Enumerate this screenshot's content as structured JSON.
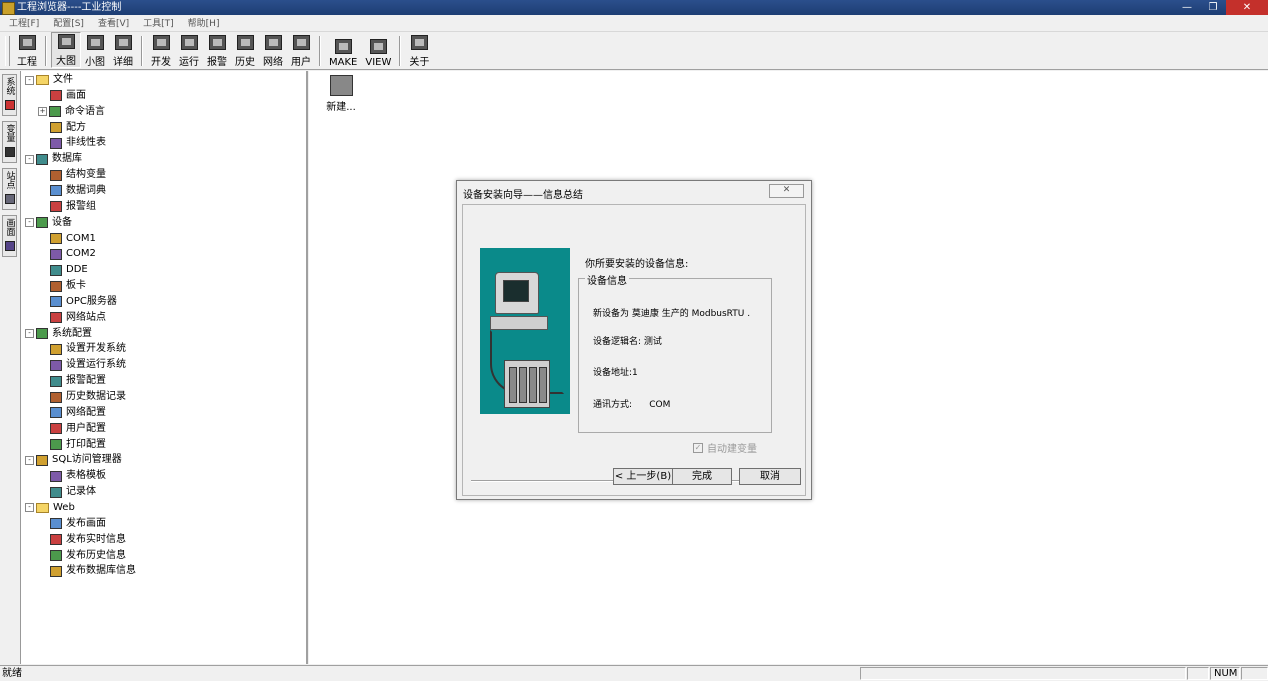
{
  "window": {
    "title": "工程浏览器----工业控制"
  },
  "menu": [
    "工程[F]",
    "配置[S]",
    "查看[V]",
    "工具[T]",
    "帮助[H]"
  ],
  "toolbar": [
    {
      "label": "工程",
      "icon": "project-icon"
    },
    {
      "label": "大图",
      "icon": "large-icons-icon",
      "active": true
    },
    {
      "label": "小图",
      "icon": "small-icons-icon"
    },
    {
      "label": "详细",
      "icon": "details-icon"
    },
    {
      "label": "开发",
      "icon": "develop-icon"
    },
    {
      "label": "运行",
      "icon": "run-icon"
    },
    {
      "label": "报警",
      "icon": "alarm-icon"
    },
    {
      "label": "历史",
      "icon": "history-icon"
    },
    {
      "label": "网络",
      "icon": "network-icon"
    },
    {
      "label": "用户",
      "icon": "user-icon"
    },
    {
      "label": "MAKE",
      "icon": "make-icon"
    },
    {
      "label": "VIEW",
      "icon": "view-icon"
    },
    {
      "label": "关于",
      "icon": "about-icon"
    }
  ],
  "vtabs": [
    "系统",
    "变量",
    "站点",
    "画面"
  ],
  "tree": [
    {
      "label": "文件",
      "level": 0,
      "exp": "-",
      "type": "folder"
    },
    {
      "label": "画面",
      "level": 1,
      "icon": "picture-icon"
    },
    {
      "label": "命令语言",
      "level": 1,
      "exp": "+",
      "icon": "command-language-icon"
    },
    {
      "label": "配方",
      "level": 1,
      "icon": "recipe-icon"
    },
    {
      "label": "非线性表",
      "level": 1,
      "icon": "nonlinear-table-icon"
    },
    {
      "label": "数据库",
      "level": 0,
      "exp": "-",
      "icon": "database-icon"
    },
    {
      "label": "结构变量",
      "level": 1,
      "icon": "struct-variable-icon"
    },
    {
      "label": "数据词典",
      "level": 1,
      "icon": "data-dictionary-icon"
    },
    {
      "label": "报警组",
      "level": 1,
      "icon": "alarm-group-icon"
    },
    {
      "label": "设备",
      "level": 0,
      "exp": "-",
      "icon": "device-icon"
    },
    {
      "label": "COM1",
      "level": 1,
      "icon": "com-port-icon"
    },
    {
      "label": "COM2",
      "level": 1,
      "icon": "com-port-icon"
    },
    {
      "label": "DDE",
      "level": 1,
      "icon": "dde-icon"
    },
    {
      "label": "板卡",
      "level": 1,
      "icon": "board-card-icon"
    },
    {
      "label": "OPC服务器",
      "level": 1,
      "icon": "opc-server-icon"
    },
    {
      "label": "网络站点",
      "level": 1,
      "icon": "network-station-icon"
    },
    {
      "label": "系统配置",
      "level": 0,
      "exp": "-",
      "icon": "tools-icon"
    },
    {
      "label": "设置开发系统",
      "level": 1,
      "icon": "dev-system-icon"
    },
    {
      "label": "设置运行系统",
      "level": 1,
      "icon": "run-system-icon"
    },
    {
      "label": "报警配置",
      "level": 1,
      "icon": "alarm-config-icon"
    },
    {
      "label": "历史数据记录",
      "level": 1,
      "icon": "history-record-icon"
    },
    {
      "label": "网络配置",
      "level": 1,
      "icon": "network-config-icon"
    },
    {
      "label": "用户配置",
      "level": 1,
      "icon": "user-config-icon"
    },
    {
      "label": "打印配置",
      "level": 1,
      "icon": "print-config-icon"
    },
    {
      "label": "SQL访问管理器",
      "level": 0,
      "exp": "-",
      "icon": "sql-manager-icon"
    },
    {
      "label": "表格模板",
      "level": 1,
      "icon": "table-template-icon"
    },
    {
      "label": "记录体",
      "level": 1,
      "icon": "record-icon"
    },
    {
      "label": "Web",
      "level": 0,
      "exp": "-",
      "type": "folder"
    },
    {
      "label": "发布画面",
      "level": 1,
      "icon": "publish-picture-icon"
    },
    {
      "label": "发布实时信息",
      "level": 1,
      "icon": "publish-realtime-icon"
    },
    {
      "label": "发布历史信息",
      "level": 1,
      "icon": "publish-history-icon"
    },
    {
      "label": "发布数据库信息",
      "level": 1,
      "icon": "publish-database-icon"
    }
  ],
  "main": {
    "new_item_label": "新建..."
  },
  "dialog": {
    "title": "设备安装向导——信息总结",
    "heading": "你所要安装的设备信息:",
    "group_label": "设备信息",
    "lines": [
      "新设备为 莫迪康 生产的 ModbusRTU .",
      "设备逻辑名: 测试",
      "设备地址:1",
      "通讯方式:      COM"
    ],
    "auto_var_label": "自动建变量",
    "auto_var_checked": true,
    "buttons": {
      "back": "< 上一步(B)",
      "finish": "完成",
      "cancel": "取消"
    }
  },
  "status": {
    "text": "就绪",
    "num": "NUM"
  }
}
